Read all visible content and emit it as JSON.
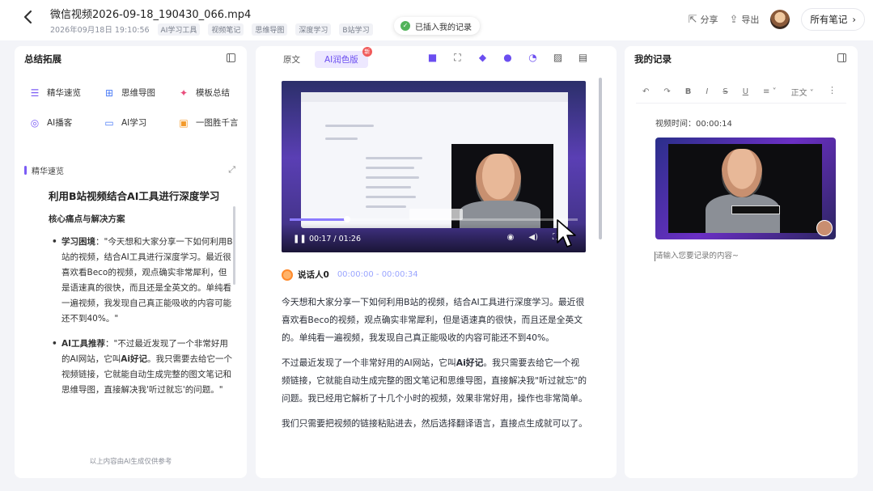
{
  "header": {
    "back_icon": "chevron-left-icon",
    "file_title": "微信视频2026-09-18_190430_066.mp4",
    "date": "2026年09月18日 19:10:56",
    "tags": [
      "AI学习工具",
      "视频笔记",
      "思维导图",
      "深度学习",
      "B站学习"
    ],
    "toast": "已插入我的记录",
    "share_label": "分享",
    "export_label": "导出",
    "all_notes_label": "所有笔记"
  },
  "left": {
    "title": "总结拓展",
    "tools": [
      {
        "label": "精华速览",
        "icon": "list-icon"
      },
      {
        "label": "思维导图",
        "icon": "mindmap-icon"
      },
      {
        "label": "模板总结",
        "icon": "sparkle-icon"
      },
      {
        "label": "AI播客",
        "icon": "podcast-icon"
      },
      {
        "label": "AI学习",
        "icon": "screen-icon"
      },
      {
        "label": "一图胜千言",
        "icon": "image-icon"
      }
    ],
    "section_label": "精华速览",
    "summary_title": "利用B站视频结合AI工具进行深度学习",
    "summary_subtitle": "核心痛点与解决方案",
    "items": [
      {
        "label": "学习困境",
        "text": "：\"今天想和大家分享一下如何利用B站的视频，结合AI工具进行深度学习。最近很喜欢看Beco的视频，观点确实非常犀利，但是语速真的很快，而且还是全英文的。单纯看一遍视频，我发现自己真正能吸收的内容可能还不到40%。\""
      },
      {
        "label": "AI工具推荐",
        "text": "：\"不过最近发现了一个非常好用的AI网站，它叫",
        "bold": "Ai好记",
        "tail": "。我只需要去给它一个视频链接，它就能自动生成完整的图文笔记和思维导图，直接解决我'听过就忘'的问题。\""
      }
    ],
    "footnote": "以上内容由AI生成仅供参考"
  },
  "middle": {
    "tab_original": "原文",
    "tab_polished": "AI润色版",
    "badge": "新",
    "video_time": "00:17 / 01:26",
    "video_progress": 0.2,
    "speaker_name": "说话人0",
    "speaker_time": "00:00:00 - 00:00:34",
    "paragraphs": [
      {
        "text": "今天想和大家分享一下如何利用B站的视频，结合AI工具进行深度学习。最近很喜欢看Beco的视频，观点确实非常犀利，但是语速真的很快，而且还是全英文的。单纯看一遍视频，我发现自己真正能吸收的内容可能还不到40%。"
      },
      {
        "text": "不过最近发现了一个非常好用的AI网站，它叫",
        "bold": "Ai好记",
        "tail": "。我只需要去给它一个视频链接，它就能自动生成完整的图文笔记和思维导图，直接解决我\"听过就忘\"的问题。我已经用它解析了十几个小时的视频，效果非常好用，操作也非常简单。"
      },
      {
        "text": "我们只需要把视频的链接粘贴进去，然后选择翻译语言，直接点生成就可以了。"
      }
    ]
  },
  "right": {
    "title": "我的记录",
    "font_label": "正文",
    "video_time_label": "视频时间：00:00:14",
    "note_placeholder": "请输入您要记录的内容~"
  },
  "colors": {
    "accent": "#6b4ef0",
    "toast_green": "#52b35a"
  }
}
